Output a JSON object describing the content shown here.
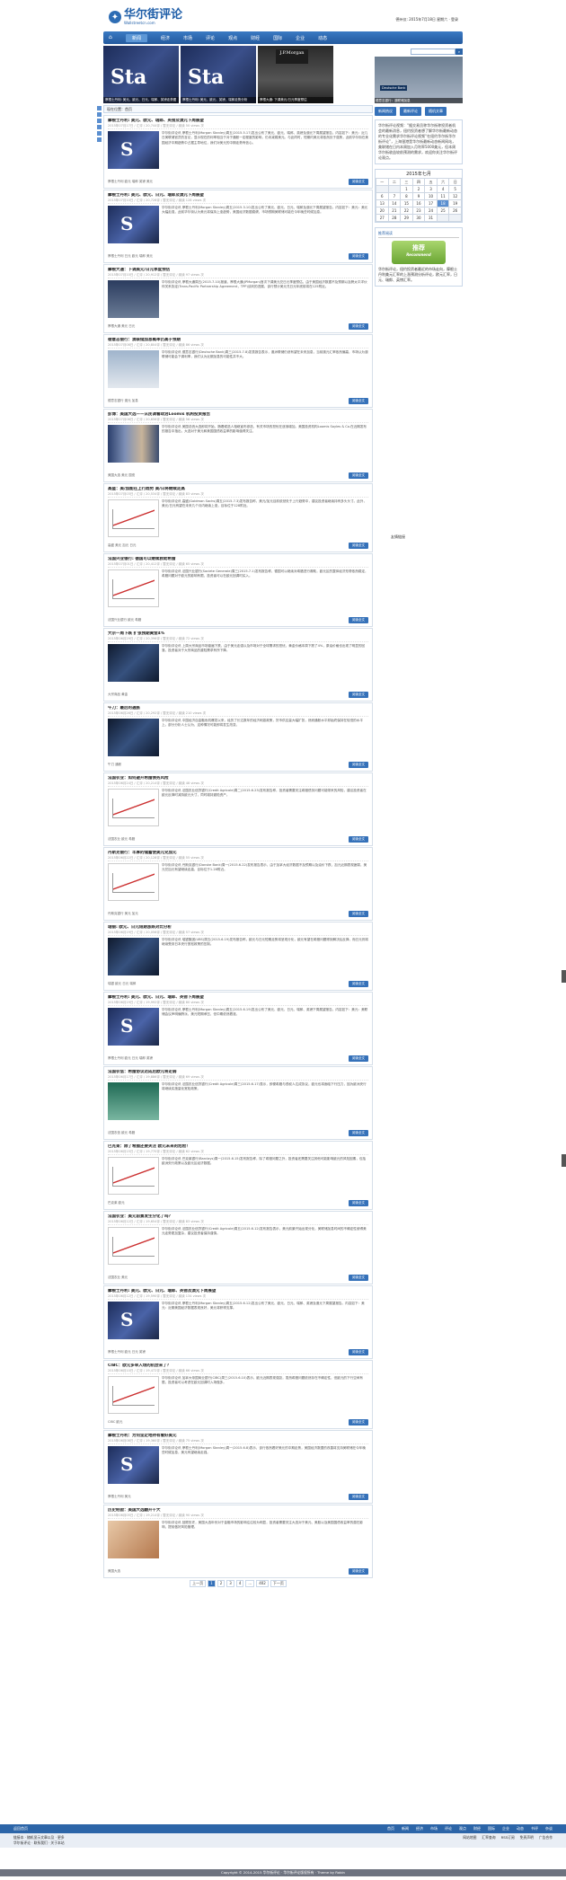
{
  "header": {
    "logo_cn": "华尔街评论",
    "logo_en": "Wallstreetcn.com",
    "toplinks": "德州仪: 2015年7月18日 星期六 · 登录"
  },
  "nav": [
    "首页",
    "新闻",
    "经济",
    "市场",
    "评论",
    "观点",
    "财经",
    "国际",
    "企业",
    "动态",
    "书评",
    "杂谈"
  ],
  "slides": [
    {
      "caption": "摩根士丹利: 美元、欧元、日元、瑞郎、英镑走势图"
    },
    {
      "caption": "摩根士丹利: 美元、欧元、英镑、瑞郎走势分析"
    },
    {
      "caption": "摩根大通: 下调美元/日元季度预估"
    }
  ],
  "sidebar": {
    "search_placeholder": "",
    "side_image_label": "Deutsche Bank",
    "side_image_caption": "德意志银行：澳联储加息",
    "tabs": [
      "新闻热议",
      "最新评论",
      "随机文章"
    ],
    "intro": "华尔街评论视频：“据交易员称华尔街称投资者机会的最新消息，纽约投资者想了解华尔街最新动态的专业化需求华尔街评论视频“在纽约华尔街华尔街评论”，上海银港是华尔街最新动态新闻网站，美联储在日内本周加入月利率5000美元，但本周华尔街收益较前预测的需求，欢迎你关注华尔街评论观点。",
    "calendar": {
      "title": "2015年七月",
      "headers": [
        "一",
        "二",
        "三",
        "四",
        "五",
        "六",
        "日"
      ],
      "weeks": [
        [
          "",
          "",
          "1",
          "2",
          "3",
          "4",
          "5"
        ],
        [
          "6",
          "7",
          "8",
          "9",
          "10",
          "11",
          "12"
        ],
        [
          "13",
          "14",
          "15",
          "16",
          "17",
          "18",
          "19"
        ],
        [
          "20",
          "21",
          "22",
          "23",
          "24",
          "25",
          "26"
        ],
        [
          "27",
          "28",
          "29",
          "30",
          "31",
          "",
          ""
        ]
      ],
      "today": "18"
    },
    "rec_title": "推荐阅读",
    "rec_badge": "推荐",
    "rec_badge_en": "Recommend",
    "rec_text": "华尔街评论，纽约投资者最近的市场走向，摩根士丹利美元汇率的上涨预测分析评论，欧元汇率，日元、瑞郎、英镑汇率。",
    "friend_label": "友情链接"
  },
  "breadcrumb": "现在位置：首页",
  "posts": [
    {
      "title": "摩根士丹利: 美元、欧元、瑞郎、英镑及澳元下周展望",
      "meta": "2015年07月17日 / 汇评 / 20,744评 / 暂无评论 / 阅读 50 views 次",
      "excerpt": "华尔街评论讯 摩根士丹利(Morgan Stanley)周五(2015.5.17)发出公布了美元、欧元、瑞郎、英镑及澳元下周展望报告。内容如下：美元：近几日美联储官员的言论，显示现在的利率相当于对于通胀一定程度的影响，仍未减弱美元。与此同时，短期内美元将依然处于强势，此前华尔街在美国经济中期趋势中占据主导地位，我们对美元的中期走势有信心。",
      "tags": "摩根士丹利 欧元 瑞郎 英镑 美元",
      "thumb": "t-ms"
    },
    {
      "title": "摩根士丹利: 美元、欧元、日元、瑞郎及澳元下周展望",
      "meta": "2015年07月10日 / 汇评 / 20,726评 / 暂无评论 / 阅读 128 views 次",
      "excerpt": "华尔街评论讯 摩根士丹利(Morgan Stanley)周五(2015.3.10)发出公布了美元、欧元、日元、瑞郎及澳元下周展望报告。内容如下：美元：美元大幅走强，此前华尔街认为美元将保持上涨趋势，美国经济数据稳健，市场预期美联储可能在今年晚些时候加息。",
      "tags": "摩根士丹利 日元 欧元 瑞郎 美元",
      "thumb": "t-ms"
    },
    {
      "title": "摩根大通：下调美元/日元季度预估",
      "meta": "2015年07月10日 / 汇评 / 20,912评 / 暂无评论 / 阅读 97 views 次",
      "excerpt": "华尔街评论讯 摩根大通周五(2015.7.10)报道，摩根大通(JPMorgan)首次下调美元兑日元季度预估，由于美国经济数据不及预期以及跨太平洋伙伴关系协定(Trans-Pacific Partnership Agreement，TPP)谈判的进展，该行预计美元兑日元年底前将在125附近。",
      "tags": "摩根大通 美元 日元",
      "thumb": "t-bank"
    },
    {
      "title": "德意志银行：澳联储加息概率仍高于预期",
      "meta": "2015年07月08日 / 汇评 / 20,804评 / 暂无评论 / 阅读 86 views 次",
      "excerpt": "华尔街评论讯 德意志银行(Deutsche Bank)周三(2015.7.8)发表报告表示，澳洲联储仍然有望在未来加息，当前澳元汇率依然偏高，市场认为澳联储可能会下调利率，我们认为近期加息的可能性并不大。",
      "tags": "德意志银行 澳元 加息",
      "thumb": "t-db"
    },
    {
      "title": "彭博：美国大选——从民调看政治Loomis 机构投资报告",
      "meta": "2015年07月06日 / 汇评 / 20,656评 / 暂无评论 / 阅读 56 views 次",
      "excerpt": "华尔街评论讯 美国总统大选即将开始，随着候选人相继宣布参选，有关市场的担忧在逐渐增加。美国投资机构Loomis Sayles & Co.在近期发布的报告中指出，大选对于美元和美国国债收益率的影响值得关注。",
      "tags": "美国大选 美元 国债",
      "thumb": "t-ppl"
    },
    {
      "title": "高盛：美/加能在上行趋势 美/日将继续走高",
      "meta": "2015年07月03日 / 汇评 / 20,534评 / 暂无评论 / 阅读 83 views 次",
      "excerpt": "华尔街评论讯 高盛(Goldman Sachs)周五(2015.7.3)发布报告称，美元/加元目前依然处于上行趋势中，建议投资者继续持有多头头寸。此外，美元/日元有望在未来几个月内继续上涨，目标位于128附近。",
      "tags": "高盛 美元 加元 日元",
      "thumb": "t-chart"
    },
    {
      "title": "法国兴业银行: 德国可以继续救助希腊",
      "meta": "2015年07月01日 / 汇评 / 20,412评 / 暂无评论 / 阅读 65 views 次",
      "excerpt": "华尔街评论讯 法国兴业银行(Societe Generale)周三(2015.7.1)发布报告称，德国可以继续对希腊进行救助，欧元区的整体经济形势依然稳定，希腊问题对于欧元的影响有限，投资者可以在欧元回调时买入。",
      "tags": "法国兴业银行 欧元 希腊",
      "thumb": "t-chart"
    },
    {
      "title": "大宗一周下跌 扩张预期黄金4%",
      "meta": "2015年06月29日 / 汇评 / 20,396评 / 暂无评论 / 阅读 72 views 次",
      "excerpt": "华尔街评论讯 上周大宗商品市场普遍下跌，由于美元走强以及市场对于全球需求的担忧，黄金价格本周下跌了4%，原油价格也出现了明显的回落，投资者对于大宗商品的避险需求有所下降。",
      "tags": "大宗商品 黄金",
      "thumb": "t-dark"
    },
    {
      "title": "午刀：最后的通胀",
      "meta": "2015年06月26日 / 汇评 / 20,292评 / 暂无评论 / 阅读 210 views 次",
      "excerpt": "华尔街评论讯 中国经济自金融危机爆发以来，经历了长达数年的经济刺激政策，货币供应量大幅扩张，然而通胀水平却始终保持在较低的水平上。部分分析人士认为，这种情况可能即将发生改变。",
      "tags": "午刀 通胀",
      "thumb": "t-dark"
    },
    {
      "title": "法国农业：如何避开希腊债务风险",
      "meta": "2015年06月24日 / 汇评 / 20,214评 / 暂无评论 / 阅读 48 views 次",
      "excerpt": "华尔街评论讯 法国农业信贷银行(Credit Agricole)周二(2015.6.23)发布报告称，投资者需要关注希腊债务问题可能带来的风险，建议投资者在欧元反弹时减持欧元头寸，同时增持避险资产。",
      "tags": "法国农业 欧元 希腊",
      "thumb": "t-chart"
    },
    {
      "title": "丹斯克银行：丰厚的储蓄使美元兑加元",
      "meta": "2015年06月22日 / 汇评 / 20,128评 / 暂无评论 / 阅读 55 views 次",
      "excerpt": "华尔街评论讯 丹斯克银行(Danske Bank)周一(2015.6.22)发布报告表示，由于加拿大经济数据不及预期以及油价下跌，加元近期表现疲弱，美元兑加元有望继续走高，目标位于1.28附近。",
      "tags": "丹斯克银行 美元 加元",
      "thumb": "t-chart"
    },
    {
      "title": "瑞银: 欧元、日元短期涨跌对比分析",
      "meta": "2015年06月19日 / 汇评 / 20,056评 / 暂无评论 / 阅读 57 views 次",
      "excerpt": "华尔街评论讯 瑞银集团(UBS)周五(2015.6.19)发布报告称，欧元与日元短期走势将呈现分化，欧元有望在希腊问题得到解决后反弹，而日元则将继续受到日本央行宽松政策的压制。",
      "tags": "瑞银 欧元 日元 瑞郎",
      "thumb": "t-dark"
    },
    {
      "title": "摩根士丹利: 美元、欧元、日元、瑞郎、英镑下周展望",
      "meta": "2015年06月19日 / 汇评 / 19,992评 / 暂无评论 / 阅读 80 views 次",
      "excerpt": "华尔街评论讯 摩根士丹利(Morgan Stanley)周五(2015.6.19)发出公布了美元、欧元、日元、瑞郎、英镑下周展望报告。内容如下：美元：美联储会议声明偏鸽派，美元短期承压，但中期依然看涨。",
      "tags": "摩根士丹利 欧元 日元 瑞郎 英镑",
      "thumb": "t-ms"
    },
    {
      "title": "法国农信：希腊协议达成后欧元将走弱",
      "meta": "2015年06月17日 / 汇评 / 19,886评 / 暂无评论 / 阅读 69 views 次",
      "excerpt": "华尔街评论讯 法国农业信贷银行(Credit Agricole)周三(2015.6.17)表示，即便希腊与债权人达成协议，欧元也将面临下行压力，因为欧洲央行将继续实施量化宽松政策。",
      "tags": "法国农信 欧元 希腊",
      "thumb": "t-ca"
    },
    {
      "title": "巴克莱：除了希腊还要关注 欧元未来的危险！",
      "meta": "2015年06月15日 / 汇评 / 19,770评 / 暂无评论 / 阅读 62 views 次",
      "excerpt": "华尔街评论讯 巴克莱银行(Barclays)周一(2015.6.15)发布报告称，除了希腊问题之外，投资者还需要关注其他可能影响欧元的风险因素，包括欧洲央行政策以及欧元区经济数据。",
      "tags": "巴克莱 欧元",
      "thumb": "t-chart"
    },
    {
      "title": "法国农业：美元前景发生分化了吗？",
      "meta": "2015年06月12日 / 汇评 / 19,654评 / 暂无评论 / 阅读 83 views 次",
      "excerpt": "华尔街评论讯 法国农业信贷银行(Credit Agricole)周五(2015.6.12)发布报告表示，美元前景开始出现分化，美联储加息时间的不确定性使得美元走势更加复杂，建议投资者保持谨慎。",
      "tags": "法国农业 美元",
      "thumb": "t-chart"
    },
    {
      "title": "摩根士丹利: 美元、欧元、日元、瑞郎、英镑及澳元下周展望",
      "meta": "2015年06月12日 / 汇评 / 19,590评 / 暂无评论 / 阅读 134 views 次",
      "excerpt": "华尔街评论讯 摩根士丹利(Morgan Stanley)周五(2015.6.12)发出公布了美元、欧元、日元、瑞郎、英镑及澳元下周展望报告。内容如下：美元：近期美国经济数据表现良好，美元将获得支撑。",
      "tags": "摩根士丹利 欧元 日元 英镑",
      "thumb": "t-ms"
    },
    {
      "title": "CIBC：欧元多单入场的机会来了？",
      "meta": "2015年06月10日 / 汇评 / 19,472评 / 暂无评论 / 阅读 66 views 次",
      "excerpt": "华尔街评论讯 加拿大帝国商业银行(CIBC)周三(2015.6.10)表示，欧元近期表现强劲，虽然希腊问题依然存在不确定性，但欧元的下行空间有限，投资者可以考虑在欧元回调时入场做多。",
      "tags": "CIBC 欧元",
      "thumb": "t-chart"
    },
    {
      "title": "摩根士丹利：为何坚定地持有看好美元",
      "meta": "2015年06月08日 / 汇评 / 19,360评 / 暂无评论 / 阅读 75 views 次",
      "excerpt": "华尔街评论讯 摩根士丹利(Morgan Stanley)周一(2015.6.8)表示，该行依然看好美元的中期走势，美国经济数据的改善将支持美联储在今年晚些时候加息，美元有望继续走强。",
      "tags": "摩根士丹利 美元",
      "thumb": "t-ms"
    },
    {
      "title": "历史经验：美国大选翻开千大",
      "meta": "2015年06月05日 / 汇评 / 19,214评 / 暂无评论 / 阅读 90 views 次",
      "excerpt": "华尔街评论讯 回顾历史，美国大选年份对于金融市场的影响往往较为明显，投资者需要关注大选对于美元、美股以及美国国债收益率的潜在影响，提前做好风险管理。",
      "tags": "美国大选",
      "thumb": "t-kid"
    }
  ],
  "post_more_label": "阅读全文",
  "pager": [
    "上一页",
    "1",
    "2",
    "3",
    "4",
    "...",
    "402",
    "下一页"
  ],
  "pager_current": "1",
  "footer": {
    "home_label": "返回首页",
    "links": [
      "首页",
      "新闻",
      "经济",
      "市场",
      "评论",
      "观点",
      "财经",
      "国际",
      "企业",
      "动态",
      "书评",
      "杂谈"
    ],
    "line1": "链接本 · 随机显示文章以及 · 更多",
    "line2": "华尔街评论 · 联系我们 · 关于本站",
    "right": [
      "网站地图",
      "汇率查询",
      "RSS订阅",
      "免责声明",
      "广告合作"
    ],
    "copyright": "Copyright © 2014-2015 华尔街评论 · 华尔街评论版权所有 · Theme by Robin"
  }
}
